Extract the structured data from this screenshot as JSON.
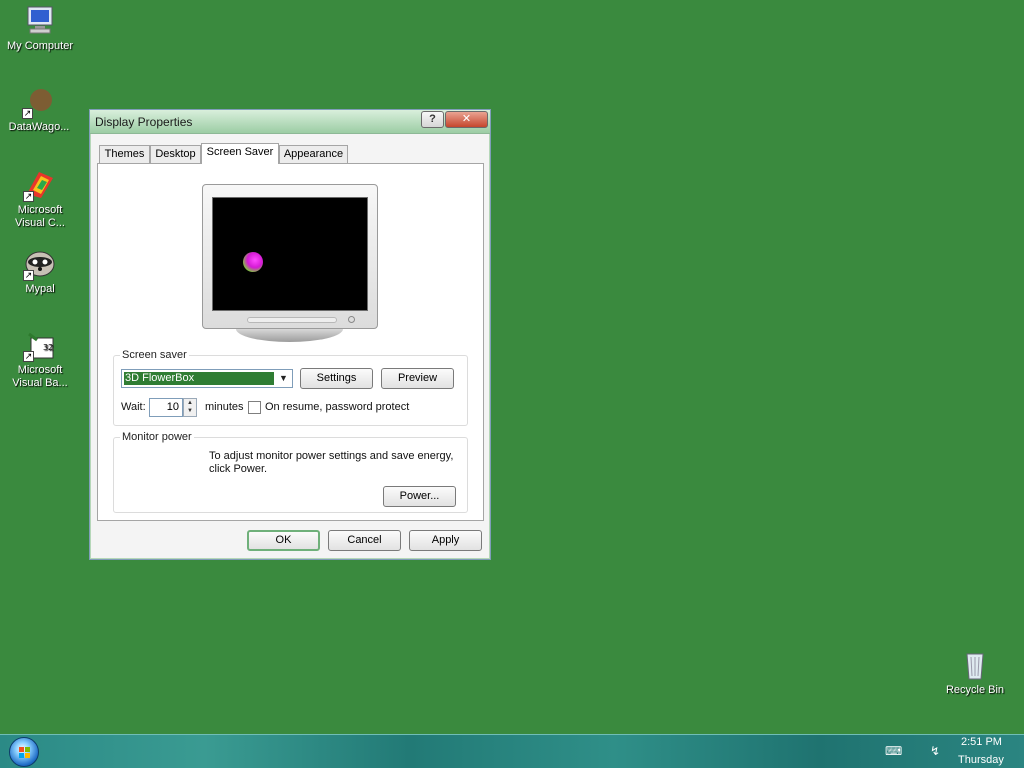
{
  "desktop": {
    "icons": [
      {
        "label": "My Computer",
        "icon": "computer-icon"
      },
      {
        "label": "DataWago...",
        "icon": "datawagon-icon"
      },
      {
        "label": "Microsoft Visual C...",
        "icon": "visual-c-icon"
      },
      {
        "label": "Mypal",
        "icon": "mypal-icon"
      },
      {
        "label": "Microsoft Visual Ba...",
        "icon": "visual-basic-icon"
      },
      {
        "label": "Recycle Bin",
        "icon": "recycle-bin-icon"
      }
    ]
  },
  "dialog": {
    "title": "Display Properties",
    "help_glyph": "?",
    "close_glyph": "✕",
    "tabs": [
      {
        "label": "Themes",
        "active": false
      },
      {
        "label": "Desktop",
        "active": false
      },
      {
        "label": "Screen Saver",
        "active": true
      },
      {
        "label": "Appearance",
        "active": false
      }
    ],
    "screen_saver": {
      "group_label": "Screen saver",
      "selected": "3D FlowerBox",
      "settings_label": "Settings",
      "preview_label": "Preview",
      "wait_label": "Wait:",
      "wait_value": "10",
      "minutes_label": "minutes",
      "password_label": "On resume, password protect",
      "password_checked": false
    },
    "monitor_power": {
      "group_label": "Monitor power",
      "description": "To adjust monitor power settings and save energy, click Power.",
      "power_label": "Power..."
    },
    "buttons": {
      "ok": "OK",
      "cancel": "Cancel",
      "apply": "Apply"
    }
  },
  "taskbar": {
    "time": "2:51 PM",
    "day": "Thursday",
    "tray_icons": [
      "keyboard-icon",
      "network-icon"
    ]
  },
  "colors": {
    "desktop_bg": "#3a8a3e",
    "selection": "#2f7d33",
    "taskbar": "#2b8a86"
  }
}
